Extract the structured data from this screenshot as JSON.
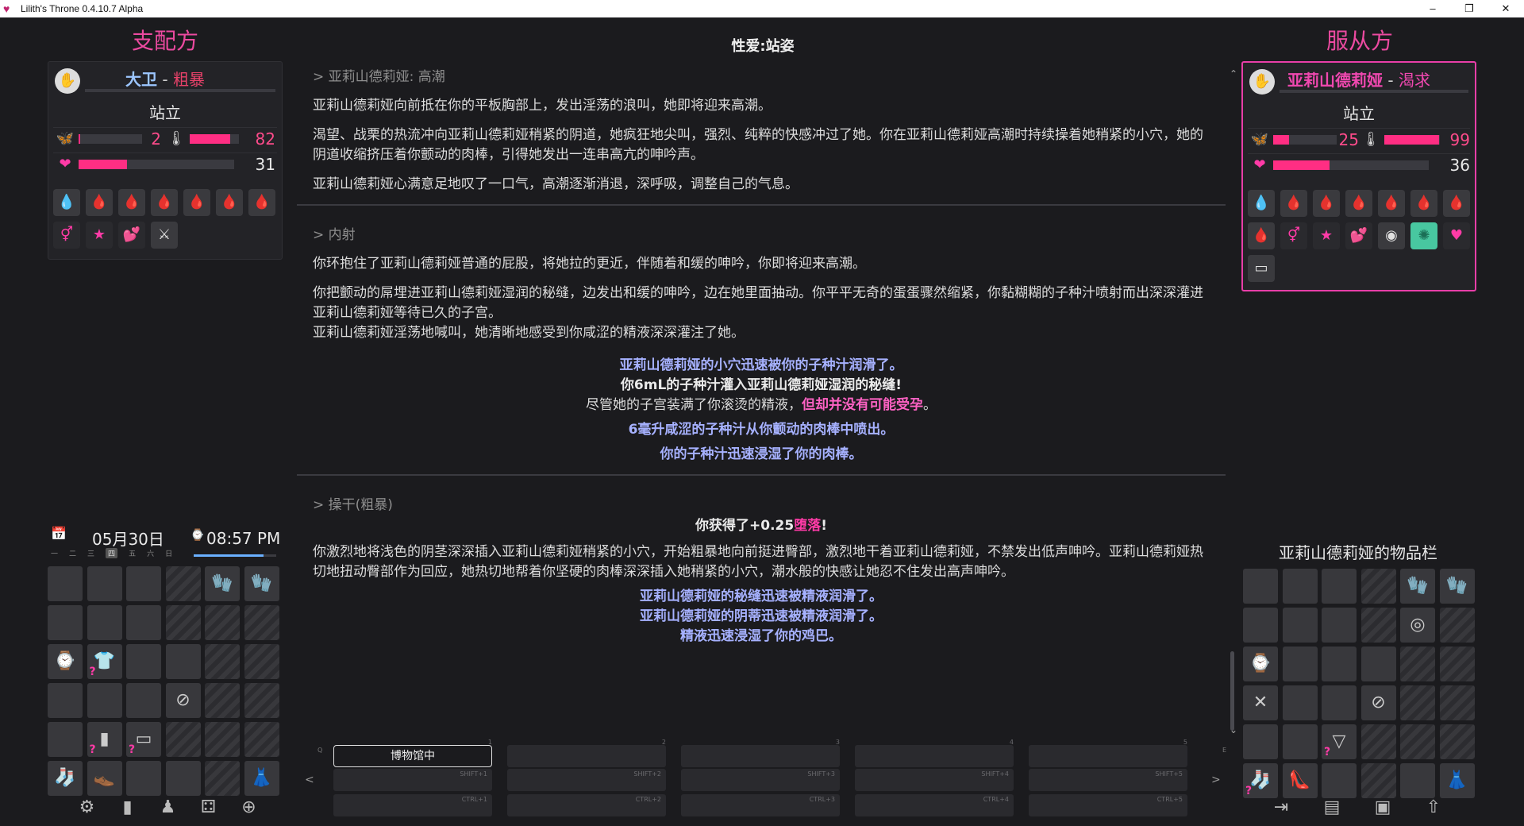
{
  "window": {
    "title": "Lilith's Throne 0.4.10.7 Alpha",
    "minimize": "–",
    "restore": "❐",
    "close": "✕"
  },
  "left_panel": {
    "title": "支配方",
    "character": {
      "name": "大卫",
      "separator": " - ",
      "mood": "粗暴",
      "pose": "站立",
      "arousal_value": "2",
      "arousal_fraction": 0.02,
      "lust_value": "82",
      "lust_fraction": 0.82,
      "energy_value": "31",
      "energy_fraction": 0.31,
      "effects": [
        "💧",
        "🩸",
        "🩸",
        "🩸",
        "🩸",
        "🩸",
        "🩸",
        "⚥",
        "★",
        "💕",
        "⚔"
      ]
    },
    "date": "05月30日",
    "time": "08:57 PM",
    "weekdays": [
      "一",
      "二",
      "三",
      "四",
      "五",
      "六",
      "日"
    ],
    "current_weekday_index": 3,
    "time_fraction": 0.85,
    "bottom_icons": [
      "⚙",
      "▮",
      "♟",
      "⚃",
      "⊕"
    ]
  },
  "right_panel": {
    "title": "服从方",
    "character": {
      "name": "亚莉山德莉娅",
      "separator": " - ",
      "mood": "渴求",
      "pose": "站立",
      "arousal_value": "25",
      "arousal_fraction": 0.25,
      "lust_value": "99",
      "lust_fraction": 0.99,
      "energy_value": "36",
      "energy_fraction": 0.36,
      "effects": [
        "💧",
        "🩸",
        "🩸",
        "🩸",
        "🩸",
        "🩸",
        "🩸",
        "🩸",
        "⚥",
        "★",
        "💕",
        "◉",
        "✺",
        "♥",
        "▭"
      ]
    },
    "inventory_title": "亚莉山德莉娅的物品栏",
    "bottom_icons": [
      "⇥",
      "▤",
      "▣",
      "⇧"
    ]
  },
  "center": {
    "title": "性爱:站姿",
    "sections": [
      {
        "head": "> 亚莉山德莉娅: 高潮",
        "paragraphs": [
          "亚莉山德莉娅向前抵在你的平板胸部上，发出淫荡的浪叫，她即将迎来高潮。",
          "渴望、战栗的热流冲向亚莉山德莉娅稍紧的阴道，她疯狂地尖叫，强烈、纯粹的快感冲过了她。你在亚莉山德莉娅高潮时持续操着她稍紧的小穴，她的阴道收缩挤压着你颤动的肉棒，引得她发出一连串高亢的呻吟声。",
          "亚莉山德莉娅心满意足地叹了一口气，高潮逐渐消退，深呼吸，调整自己的气息。"
        ]
      },
      {
        "head": "> 内射",
        "paragraphs": [
          "你环抱住了亚莉山德莉娅普通的屁股，将她拉的更近，伴随着和缓的呻吟，你即将迎来高潮。",
          "你把颤动的屌埋进亚莉山德莉娅湿润的秘缝，边发出和缓的呻吟，边在她里面抽动。你平平无奇的蛋蛋骤然缩紧，你黏糊糊的子种汁喷射而出深深灌进亚莉山德莉娅等待已久的子宫。",
          "亚莉山德莉娅淫荡地喊叫，她清晰地感受到你咸涩的精液深深灌注了她。"
        ],
        "notices": [
          "亚莉山德莉娅的小穴迅速被你的子种汁润滑了。",
          "你6mL的子种汁灌入亚莉山德莉娅湿润的秘缝!",
          "尽管她的子宫装满了你滚烫的精液，",
          "但却并没有可能受孕",
          "。",
          "6毫升咸涩的子种汁从你颤动的肉棒中喷出。",
          "你的子种汁迅速浸湿了你的肉棒。"
        ]
      },
      {
        "head": "> 操干(粗暴)",
        "gain_prefix": "你获得了+0.25",
        "gain_word": "堕落",
        "gain_suffix": "!",
        "paragraphs": [
          "你激烈地将浅色的阴茎深深插入亚莉山德莉娅稍紧的小穴，开始粗暴地向前挺进臀部，激烈地干着亚莉山德莉娅，不禁发出低声呻吟。亚莉山德莉娅热切地扭动臀部作为回应，她热切地帮着你坚硬的肉棒深深插入她稍紧的小穴，潮水般的快感让她忍不住发出高声呻吟。"
        ],
        "notices": [
          "亚莉山德莉娅的秘缝迅速被精液润滑了。",
          "亚莉山德莉娅的阴蒂迅速被精液润滑了。",
          "精液迅速浸湿了你的鸡巴。"
        ]
      }
    ]
  },
  "actions": {
    "active_label": "博物馆中",
    "columns": [
      {
        "num": "1",
        "shift": "SHIFT+1",
        "ctrl": "CTRL+1"
      },
      {
        "num": "2",
        "shift": "SHIFT+2",
        "ctrl": "CTRL+2"
      },
      {
        "num": "3",
        "shift": "SHIFT+3",
        "ctrl": "CTRL+3"
      },
      {
        "num": "4",
        "shift": "SHIFT+4",
        "ctrl": "CTRL+4"
      },
      {
        "num": "5",
        "shift": "SHIFT+5",
        "ctrl": "CTRL+5"
      }
    ],
    "left_key": "Q",
    "right_key": "E",
    "prev": "<",
    "next": ">"
  },
  "left_inventory": [
    {
      "t": "e"
    },
    {
      "t": "e"
    },
    {
      "t": "e"
    },
    {
      "t": "b"
    },
    {
      "t": "i",
      "g": "🧤"
    },
    {
      "t": "i",
      "g": "🧤"
    },
    {
      "t": "e"
    },
    {
      "t": "e"
    },
    {
      "t": "e"
    },
    {
      "t": "b"
    },
    {
      "t": "b"
    },
    {
      "t": "b"
    },
    {
      "t": "i",
      "g": "⌚"
    },
    {
      "t": "i",
      "g": "👕",
      "q": "?"
    },
    {
      "t": "e"
    },
    {
      "t": "e"
    },
    {
      "t": "b"
    },
    {
      "t": "b"
    },
    {
      "t": "e"
    },
    {
      "t": "e"
    },
    {
      "t": "e"
    },
    {
      "t": "i",
      "g": "⊘"
    },
    {
      "t": "b"
    },
    {
      "t": "b"
    },
    {
      "t": "e"
    },
    {
      "t": "i",
      "g": "▮",
      "q": "?"
    },
    {
      "t": "i",
      "g": "▭",
      "q": "?"
    },
    {
      "t": "b"
    },
    {
      "t": "b"
    },
    {
      "t": "b"
    },
    {
      "t": "i",
      "g": "🧦"
    },
    {
      "t": "i",
      "g": "👞"
    },
    {
      "t": "e"
    },
    {
      "t": "e"
    },
    {
      "t": "b"
    },
    {
      "t": "i",
      "g": "👗"
    }
  ],
  "right_inventory": [
    {
      "t": "e"
    },
    {
      "t": "e"
    },
    {
      "t": "e"
    },
    {
      "t": "b"
    },
    {
      "t": "i",
      "g": "🧤"
    },
    {
      "t": "i",
      "g": "🧤"
    },
    {
      "t": "e"
    },
    {
      "t": "e"
    },
    {
      "t": "e"
    },
    {
      "t": "b"
    },
    {
      "t": "i",
      "g": "◎"
    },
    {
      "t": "b"
    },
    {
      "t": "i",
      "g": "⌚"
    },
    {
      "t": "e"
    },
    {
      "t": "e"
    },
    {
      "t": "e"
    },
    {
      "t": "b"
    },
    {
      "t": "b"
    },
    {
      "t": "i",
      "g": "✕"
    },
    {
      "t": "e"
    },
    {
      "t": "e"
    },
    {
      "t": "i",
      "g": "⊘"
    },
    {
      "t": "b"
    },
    {
      "t": "b"
    },
    {
      "t": "e"
    },
    {
      "t": "e"
    },
    {
      "t": "i",
      "g": "▽",
      "q": "?"
    },
    {
      "t": "b"
    },
    {
      "t": "b"
    },
    {
      "t": "b"
    },
    {
      "t": "i",
      "g": "🧦",
      "q": "?"
    },
    {
      "t": "i",
      "g": "👠"
    },
    {
      "t": "e"
    },
    {
      "t": "b"
    },
    {
      "t": "e"
    },
    {
      "t": "i",
      "g": "👗"
    }
  ]
}
